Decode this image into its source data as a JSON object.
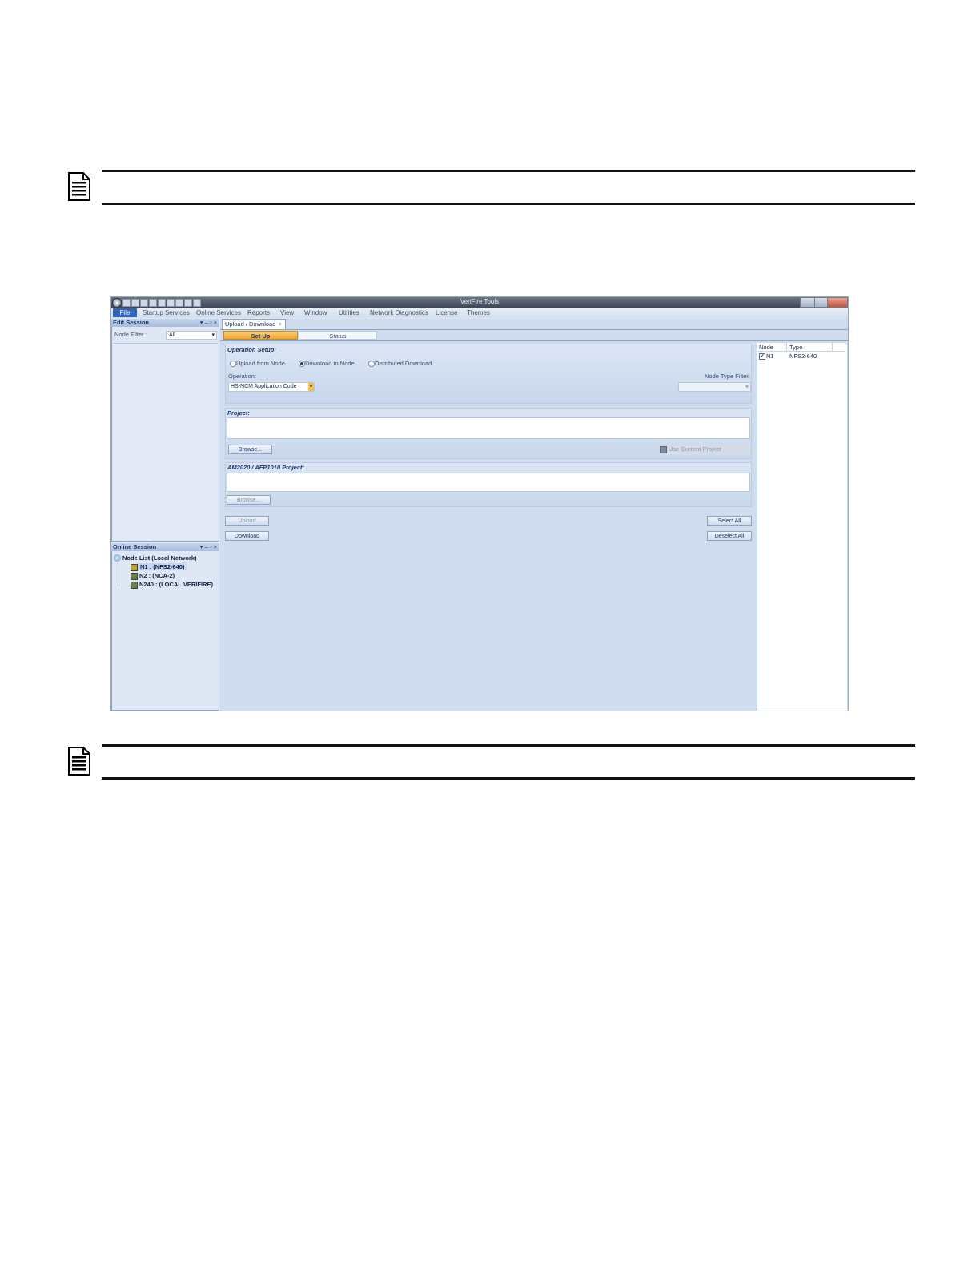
{
  "window": {
    "title": "VeriFire Tools",
    "menu": [
      "File",
      "Startup Services",
      "Online Services",
      "Reports",
      "View",
      "Window",
      "Utilities",
      "Network Diagnostics",
      "License",
      "Themes"
    ]
  },
  "edit_session": {
    "header": "Edit Session",
    "controls": "▾  –  ▫  ×",
    "node_filter_label": "Node Filter :",
    "node_filter_value": "All"
  },
  "online_session": {
    "header": "Online Session",
    "controls": "▾  –  ▫  ×",
    "tree_root": "Node List (Local Network)",
    "nodes": [
      "N1 : (NFS2-640)",
      "N2 : (NCA-2)",
      "N240 : (LOCAL VERIFIRE)"
    ]
  },
  "document_tab": {
    "label": "Upload / Download",
    "close": "×"
  },
  "subtabs": [
    "Set Up",
    "Status"
  ],
  "operation_setup": {
    "title": "Operation Setup:",
    "radios": [
      {
        "label": "Upload from Node",
        "selected": false
      },
      {
        "label": "Download to Node",
        "selected": true
      },
      {
        "label": "Distributed Download",
        "selected": false
      }
    ],
    "operation_label": "Operation:",
    "operation_value": "HS-NCM Application Code",
    "node_type_filter_label": "Node Type Filter:",
    "node_type_filter_value": ""
  },
  "project": {
    "title": "Project:",
    "value": "",
    "browse": "Browse...",
    "use_current": "Use Current Project"
  },
  "am2020_project": {
    "title": "AM2020 / AFP1010 Project:",
    "value": "",
    "browse": "Browse..."
  },
  "actions": {
    "upload": "Upload",
    "download": "Download",
    "select_all": "Select All",
    "deselect_all": "Deselect All"
  },
  "node_table": {
    "headers": [
      "Node",
      "Type"
    ],
    "rows": [
      {
        "checked": true,
        "node": "N1",
        "type": "NFS2-640"
      }
    ]
  },
  "colors": {
    "accent_tab": "#f7b23e",
    "panel_bg": "#dfe7f5",
    "header_blue": "#1a3670"
  }
}
